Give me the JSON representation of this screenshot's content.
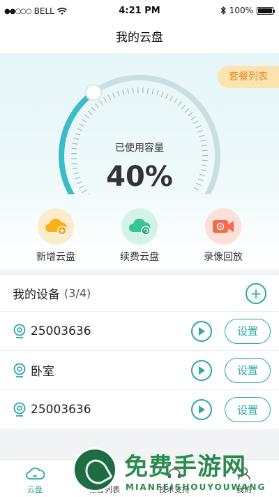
{
  "status_bar": {
    "signal": "●●○○○",
    "carrier": "BELL",
    "time": "4:21 PM",
    "battery": "100%"
  },
  "nav": {
    "title": "我的云盘"
  },
  "hero": {
    "plan_tag": "套餐列表",
    "gauge_label": "已使用容量",
    "gauge_value": "40%",
    "usage_fraction": 0.4,
    "accent_color": "#3cbcc8"
  },
  "actions": [
    {
      "label": "新增云盘",
      "icon": "cloud-add-icon",
      "color": "#f7b21b"
    },
    {
      "label": "续费云盘",
      "icon": "cloud-renew-icon",
      "color": "#37c596"
    },
    {
      "label": "录像回放",
      "icon": "video-camera-icon",
      "color": "#f46a4a"
    }
  ],
  "devices": {
    "title": "我的设备",
    "count": "(3/4)",
    "items": [
      {
        "name": "25003636",
        "settings_label": "设置"
      },
      {
        "name": "卧室",
        "settings_label": "设置"
      },
      {
        "name": "25003636",
        "settings_label": "设置"
      }
    ]
  },
  "tabs": [
    {
      "label": "云盘",
      "icon": "cloud-icon",
      "active": true
    },
    {
      "label": "报警列表",
      "icon": "list-icon",
      "active": false
    },
    {
      "label": "技术支持",
      "icon": "support-icon",
      "active": false
    },
    {
      "label": "我的",
      "icon": "user-icon",
      "active": false
    }
  ],
  "watermark": {
    "text": "免费手游网",
    "sub": "MIANFEISHOUYOUWANG"
  }
}
